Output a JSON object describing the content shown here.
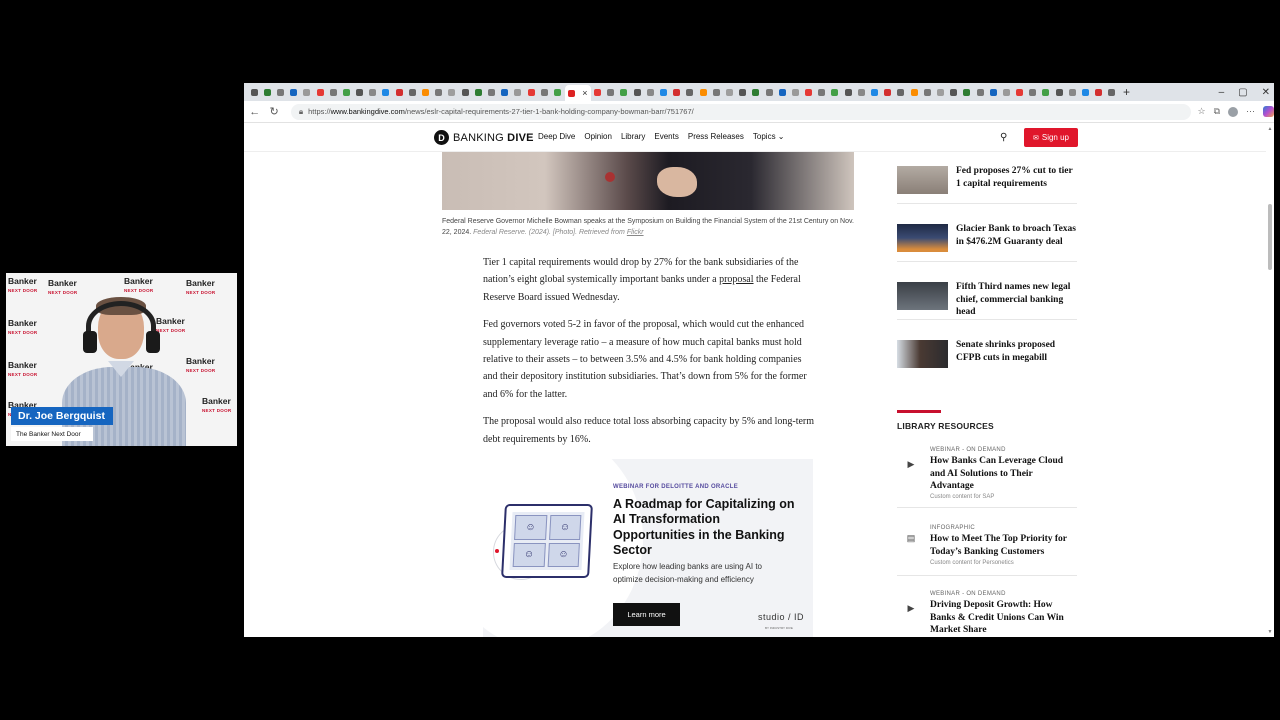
{
  "browser": {
    "url_prefix": "https://",
    "url_domain": "www.bankingdive.com",
    "url_path": "/news/eslr-capital-requirements-27-tier-1-bank-holding-company-bowman-barr/751767/",
    "tab_close": "×",
    "new_tab": "+",
    "controls": {
      "minimize": "–",
      "maximize": "▢",
      "close": "✕"
    },
    "nav": {
      "back": "←",
      "reload": "↻"
    }
  },
  "site": {
    "logo_mark": "D",
    "logo_text_1": "BANKING ",
    "logo_text_2": "DIVE",
    "nav": [
      "Deep Dive",
      "Opinion",
      "Library",
      "Events",
      "Press Releases",
      "Topics ⌄"
    ],
    "signup_label": "Sign up"
  },
  "article": {
    "caption": "Federal Reserve Governor Michelle Bowman speaks at the Symposium on Building the Financial System of the 21st Century on Nov. 22, 2024.",
    "caption_credit": "Federal Reserve. (2024). [Photo]. Retrieved from",
    "caption_link": "Flickr",
    "p1_a": "Tier 1 capital requirements would drop by 27% for the bank subsidiaries of the nation’s eight global systemically important banks under a ",
    "p1_link": "proposal",
    "p1_b": " the Federal Reserve Board issued Wednesday.",
    "p2": "Fed governors voted 5-2 in favor of the proposal, which would cut the enhanced supplementary leverage ratio – a measure of how much capital banks must hold relative to their assets – to between 3.5% and 4.5% for bank holding companies and their depository institution subsidiaries. That’s down from 5% for the former and 6% for the latter.",
    "p3": "The proposal would also reduce total loss absorbing capacity by 5% and long-term debt requirements by 16%."
  },
  "ad": {
    "kicker": "WEBINAR FOR DELOITTE AND ORACLE",
    "title": "A Roadmap for Capitalizing on AI Transformation Opportunities in the Banking Sector",
    "desc": "Explore how leading banks are using AI to optimize decision-making and efficiency",
    "button": "Learn more",
    "brand": "studio / ID",
    "brand_sub": "BY INDUSTRY DIVE"
  },
  "sidebar": {
    "stories": [
      {
        "title": "Fed proposes 27% cut to tier 1 capital requirements"
      },
      {
        "title": "Glacier Bank to broach Texas in $476.2M Guaranty deal"
      },
      {
        "title": "Fifth Third names new legal chief, commercial banking head"
      },
      {
        "title": "Senate shrinks proposed CFPB cuts in megabill"
      }
    ],
    "library_heading": "LIBRARY RESOURCES",
    "library": [
      {
        "type": "WEBINAR - ON DEMAND",
        "title": "How Banks Can Leverage Cloud and AI Solutions to Their Advantage",
        "sponsor": "Custom content for SAP",
        "icon": "▶"
      },
      {
        "type": "INFOGRAPHIC",
        "title": "How to Meet The Top Priority for Today’s Banking Customers",
        "sponsor": "Custom content for Personetics",
        "icon": "▤"
      },
      {
        "type": "WEBINAR - ON DEMAND",
        "title": "Driving Deposit Growth: How Banks & Credit Unions Can Win Market Share",
        "sponsor": "",
        "icon": "▶"
      }
    ]
  },
  "webcam": {
    "name": "Dr. Joe Bergquist",
    "subtitle": "The Banker Next Door",
    "watermark": "Banker",
    "watermark_sub": "NEXT DOOR"
  }
}
